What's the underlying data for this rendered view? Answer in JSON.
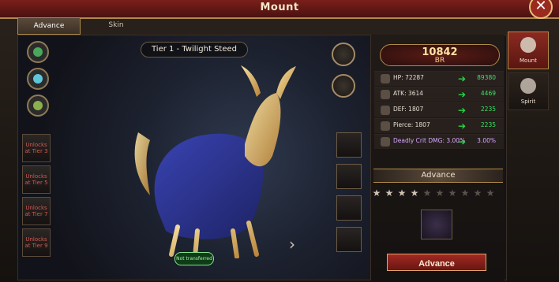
{
  "window": {
    "title": "Mount",
    "close_symbol": "✕"
  },
  "tabs": [
    {
      "label": "Advance",
      "active": true
    },
    {
      "label": "Skin",
      "active": false
    }
  ],
  "mount": {
    "tier_title": "Tier 1 - Twilight Steed",
    "status_label": "Not transferred"
  },
  "right_panel": {
    "br_value": "10842",
    "br_label": "BR",
    "stats": [
      {
        "name": "HP",
        "current": "72287",
        "next": "89380",
        "icon": "hp-icon"
      },
      {
        "name": "ATK",
        "current": "3614",
        "next": "4469",
        "icon": "atk-icon"
      },
      {
        "name": "DEF",
        "current": "1807",
        "next": "2235",
        "icon": "def-icon"
      },
      {
        "name": "Pierce",
        "current": "1807",
        "next": "2235",
        "icon": "pierce-icon"
      },
      {
        "name": "Deadly Crit DMG",
        "current": "3.00%",
        "next": "3.00%",
        "icon": "crit-icon"
      }
    ],
    "advance_label": "Advance",
    "stars": {
      "total": 10,
      "filled": 4
    },
    "advance_button": "Advance"
  },
  "side_tabs": [
    {
      "label": "Mount",
      "active": true
    },
    {
      "label": "Spirit",
      "active": false
    }
  ],
  "left_column": {
    "skills": [
      {
        "icon": "wind-skill-icon"
      },
      {
        "icon": "wave-skill-icon"
      },
      {
        "icon": "gear-skill-icon"
      }
    ],
    "locked_slots": [
      {
        "label": "Unlocks at Tier 3"
      },
      {
        "label": "Unlocks at Tier 5"
      },
      {
        "label": "Unlocks at Tier 7"
      },
      {
        "label": "Unlocks at Tier 9"
      }
    ]
  },
  "middle_controls": {
    "top_buttons": [
      {
        "icon": "wardrobe-icon"
      },
      {
        "icon": "compass-icon"
      }
    ],
    "equip_slots": [
      {
        "icon": "saddle-icon"
      },
      {
        "icon": "armor-icon"
      },
      {
        "icon": "rein-icon"
      },
      {
        "icon": "hoof-icon"
      }
    ],
    "next_arrow": "›"
  },
  "colors": {
    "accent_red": "#a02a22",
    "stat_green": "#43e06a",
    "crit_purple": "#d8a6ff",
    "gold_border": "#b08a4a"
  }
}
